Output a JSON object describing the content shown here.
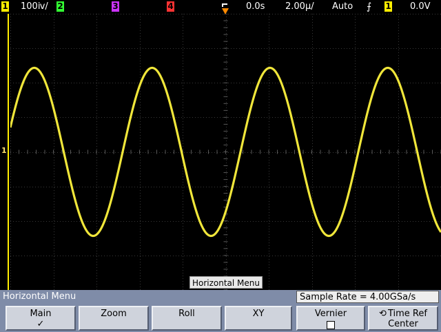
{
  "topbar": {
    "ch1": {
      "number": "1",
      "scale": "100ⅳ/",
      "color": "#ffee00"
    },
    "ch2": {
      "number": "2",
      "color": "#33ff33"
    },
    "ch3": {
      "number": "3",
      "color": "#cc33ff"
    },
    "ch4": {
      "number": "4",
      "color": "#ff3333"
    },
    "delay": "0.0s",
    "timebase": "2.00µ/",
    "trigger_mode": "Auto",
    "trigger_slope_icon": "rising-edge-icon",
    "trigger_slope_glyph": "⨍",
    "trigger_source": "1",
    "trigger_level": "0.0V"
  },
  "screen": {
    "waveform_color": "#f0e63a",
    "ground_marker": "1",
    "label": "Horizontal Menu"
  },
  "menu": {
    "title": "Horizontal Menu",
    "sample_rate": "Sample Rate = 4.00GSa/s",
    "softkeys": [
      {
        "label": "Main",
        "sub": "✓",
        "selected": true
      },
      {
        "label": "Zoom",
        "sub": ""
      },
      {
        "label": "Roll",
        "sub": ""
      },
      {
        "label": "XY",
        "sub": ""
      },
      {
        "label": "Vernier",
        "sub": ""
      },
      {
        "label": "Time Ref",
        "sub": "Center",
        "icon": "rotate-icon"
      }
    ]
  }
}
